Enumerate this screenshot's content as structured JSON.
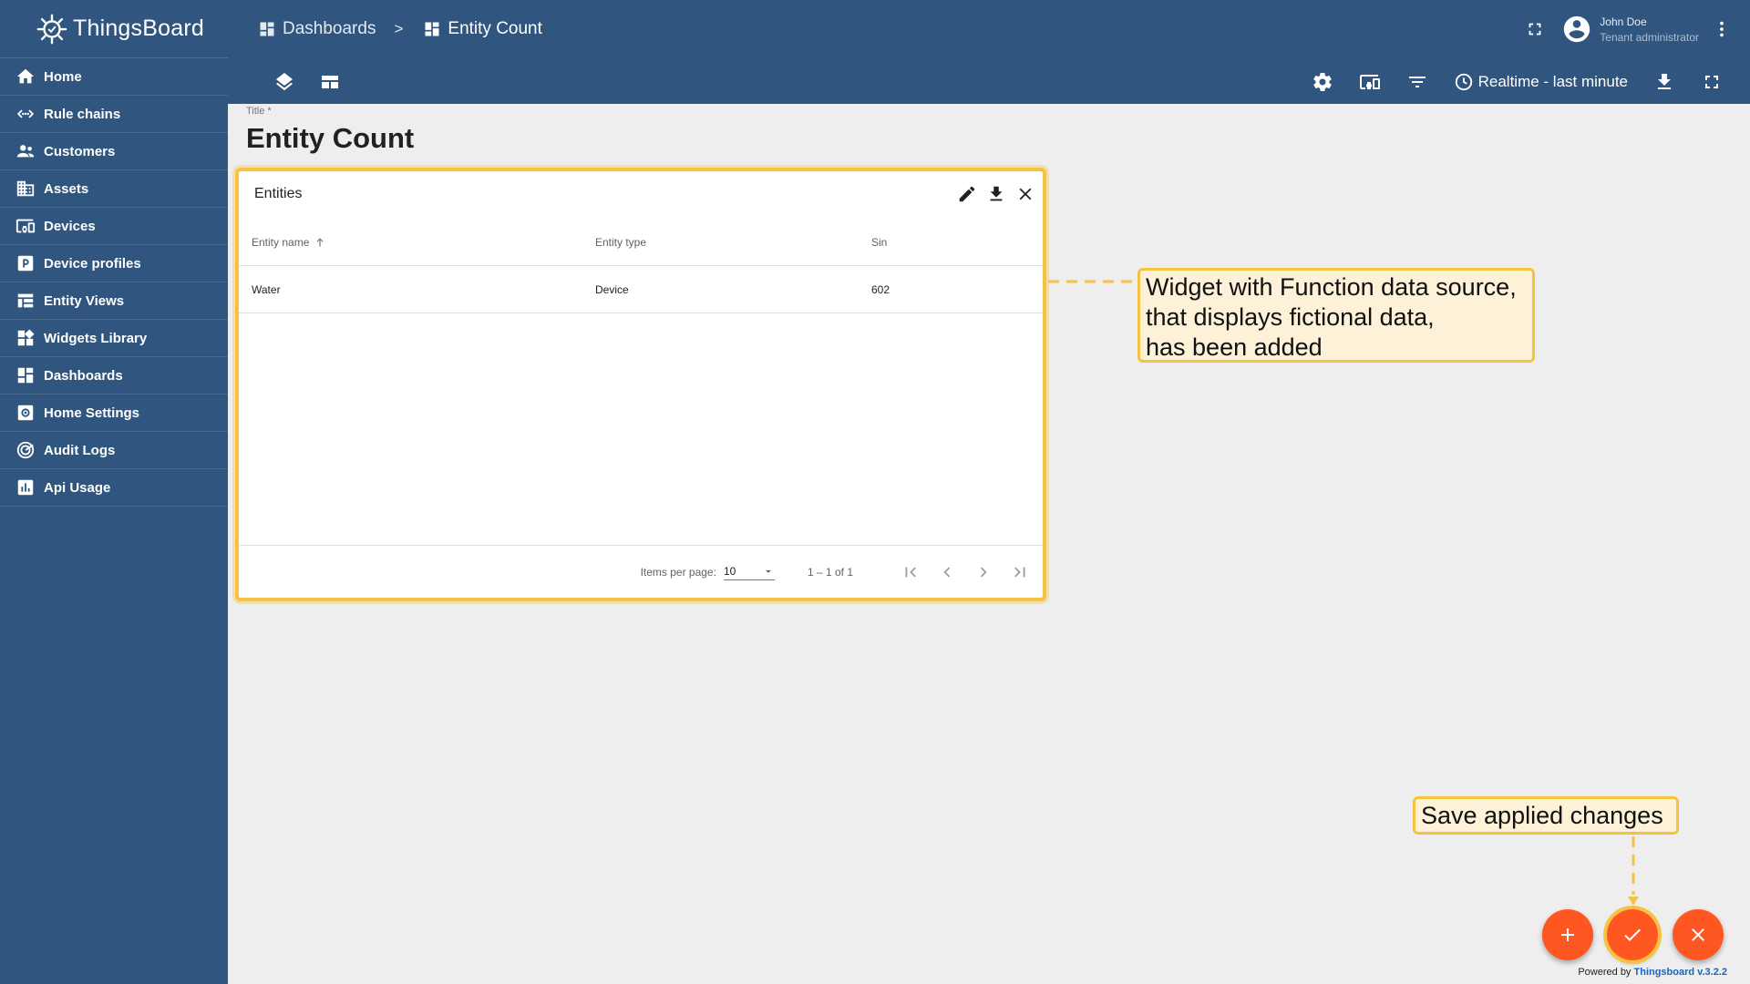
{
  "app": {
    "name": "ThingsBoard"
  },
  "sidebar": {
    "items": [
      {
        "label": "Home",
        "icon": "home-icon"
      },
      {
        "label": "Rule chains",
        "icon": "rule-chains-icon"
      },
      {
        "label": "Customers",
        "icon": "customers-icon"
      },
      {
        "label": "Assets",
        "icon": "assets-icon"
      },
      {
        "label": "Devices",
        "icon": "devices-icon"
      },
      {
        "label": "Device profiles",
        "icon": "device-profiles-icon"
      },
      {
        "label": "Entity Views",
        "icon": "entity-views-icon"
      },
      {
        "label": "Widgets Library",
        "icon": "widgets-library-icon"
      },
      {
        "label": "Dashboards",
        "icon": "dashboards-icon"
      },
      {
        "label": "Home Settings",
        "icon": "home-settings-icon"
      },
      {
        "label": "Audit Logs",
        "icon": "audit-logs-icon"
      },
      {
        "label": "Api Usage",
        "icon": "api-usage-icon"
      }
    ]
  },
  "header": {
    "breadcrumbs": [
      {
        "label": "Dashboards",
        "icon": "dashboards-icon"
      },
      {
        "label": "Entity Count",
        "icon": "dashboard-icon"
      }
    ],
    "separator": ">",
    "user": {
      "name": "John Doe",
      "role": "Tenant administrator"
    },
    "timewindow": "Realtime - last minute"
  },
  "dashboard": {
    "title_label": "Title *",
    "title": "Entity Count"
  },
  "widget": {
    "title": "Entities",
    "columns": [
      "Entity name",
      "Entity type",
      "Sin"
    ],
    "rows": [
      [
        "Water",
        "Device",
        "602"
      ]
    ],
    "paginator": {
      "items_per_page_label": "Items per page:",
      "items_per_page": "10",
      "range": "1 – 1 of 1"
    }
  },
  "annotations": {
    "callout_1_lines": [
      "Widget with Function data source,",
      "that displays fictional data,",
      "has been added"
    ],
    "callout_2": "Save applied changes"
  },
  "footer": {
    "powered_by": "Powered by",
    "brand_version": "Thingsboard v.3.2.2"
  },
  "colors": {
    "sidebar": "#305680",
    "accent": "#ff5722",
    "highlight": "#f5c242",
    "background": "#eeeeee"
  }
}
